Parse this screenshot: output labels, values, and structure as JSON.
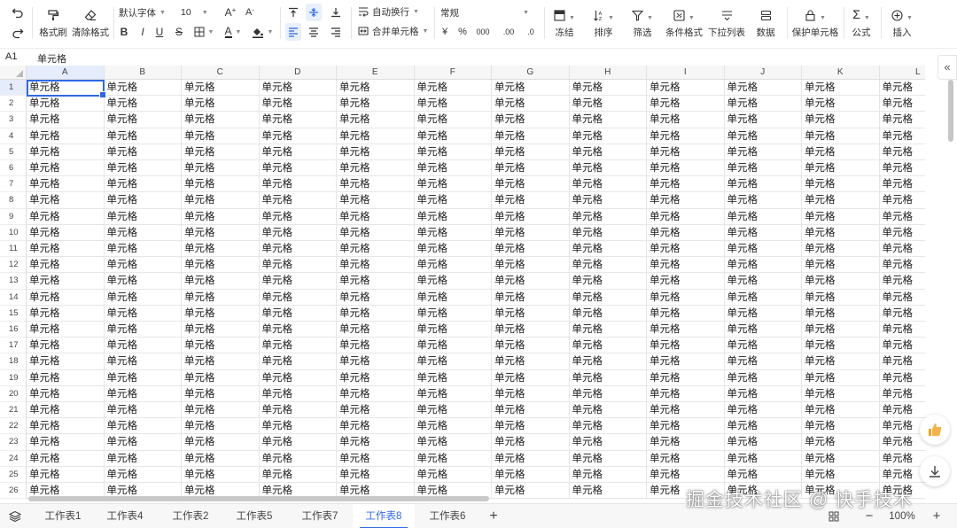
{
  "toolbar": {
    "undo_icon": "undo-icon",
    "redo_icon": "redo-icon",
    "format_painter_label": "格式刷",
    "clear_format_label": "清除格式",
    "font_family": "默认字体",
    "font_size": "10",
    "bold": "B",
    "italic": "I",
    "underline": "U",
    "strike": "S",
    "font_color_letter": "A",
    "increase_font": "A",
    "decrease_font": "A",
    "wrap_text_label": "自动换行",
    "merge_cells_label": "合并单元格",
    "number_format": "常规",
    "currency": "¥",
    "percent": "%",
    "thousands": "000",
    "decimal_dec": ".00",
    "decimal_inc": ".0",
    "freeze_label": "冻结",
    "sort_label": "排序",
    "filter_label": "筛选",
    "conditional_format_label": "条件格式",
    "dropdown_list_label": "下拉列表",
    "data_label": "数据",
    "protect_cells_label": "保护单元格",
    "formula_label": "公式",
    "insert_label": "插入"
  },
  "formula_bar": {
    "cell_ref": "A1",
    "value": "单元格"
  },
  "grid": {
    "columns": [
      "A",
      "B",
      "C",
      "D",
      "E",
      "F",
      "G",
      "H",
      "I",
      "J",
      "K",
      "L"
    ],
    "rows": [
      "1",
      "2",
      "3",
      "4",
      "5",
      "6",
      "7",
      "8",
      "9",
      "10",
      "11",
      "12",
      "13",
      "14",
      "15",
      "16",
      "17",
      "18",
      "19",
      "20",
      "21",
      "22",
      "23",
      "24",
      "25",
      "26"
    ],
    "cell_value": "单元格"
  },
  "sheet_tabs": [
    "工作表1",
    "工作表4",
    "工作表2",
    "工作表5",
    "工作表7",
    "工作表8",
    "工作表6"
  ],
  "active_sheet": "工作表8",
  "add_sheet": "+",
  "zoom": {
    "minus": "−",
    "value": "100%",
    "plus": "+"
  },
  "collapse_label": "«",
  "watermark": "掘金技术社区 @ 快手技术",
  "colors": {
    "accent": "#2f6ae6",
    "header_bg": "#f6f6f6",
    "selected_header": "#e5ecfb"
  }
}
